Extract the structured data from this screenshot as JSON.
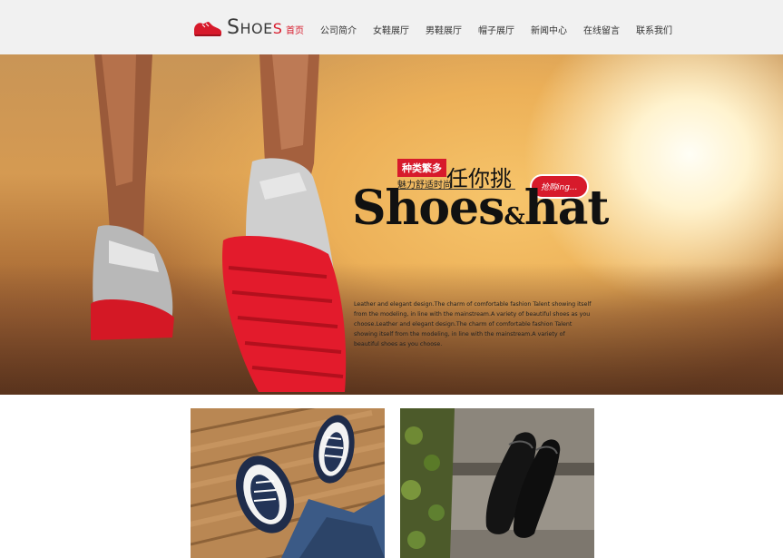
{
  "brand": {
    "logo_text_lead": "S",
    "logo_text_rest": "HOE",
    "logo_text_tail": "S",
    "accent": "#d71a2b"
  },
  "nav": {
    "items": [
      {
        "label": "首页",
        "active": true
      },
      {
        "label": "公司简介"
      },
      {
        "label": "女鞋展厅"
      },
      {
        "label": "男鞋展厅"
      },
      {
        "label": "帽子展厅"
      },
      {
        "label": "新闻中心"
      },
      {
        "label": "在线留言"
      },
      {
        "label": "联系我们"
      }
    ]
  },
  "banner": {
    "tag_red": "种类繁多",
    "tag_sub": "魅力舒适时尚",
    "tag_big": "任你挑",
    "buy_badge": "抢购ing...",
    "headline_a": "Shoes",
    "headline_amp": "&",
    "headline_b": "hat",
    "description": "Leather and elegant design.The charm of comfortable fashion Talent showing itself from the modeling, in line with the mainstream.A variety of beautiful shoes as you choose.Leather and elegant design.The charm of comfortable fashion Talent showing itself from the modeling, in line with the mainstream.A variety of beautiful shoes as you choose."
  },
  "gallery": {
    "items": [
      {
        "name": "sneakers-on-wood"
      },
      {
        "name": "black-leather-shoes"
      }
    ]
  }
}
